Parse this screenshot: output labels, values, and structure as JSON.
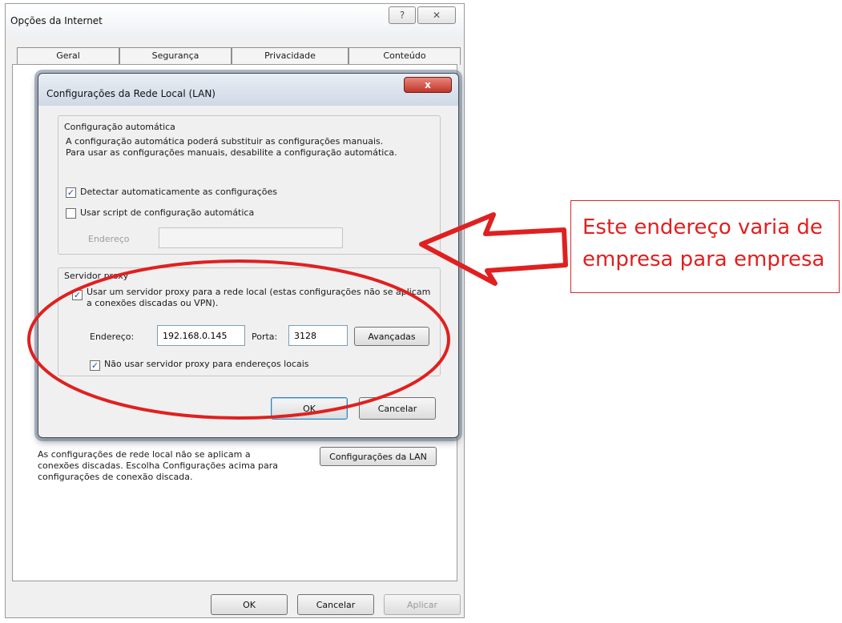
{
  "outer_window": {
    "title": "Opções da Internet",
    "help_label": "?",
    "close_label": "✕",
    "tabs": [
      "Geral",
      "Segurança",
      "Privacidade",
      "Conteúdo"
    ],
    "lan_note": "As configurações de rede local não se aplicam a conexões discadas. Escolha Configurações acima para configurações de conexão discada.",
    "lan_settings_button": "Configurações da LAN",
    "buttons": {
      "ok": "OK",
      "cancel": "Cancelar",
      "apply": "Aplicar"
    }
  },
  "lan_dialog": {
    "title": "Configurações da Rede Local (LAN)",
    "close_label": "x",
    "auto_config": {
      "legend": "Configuração automática",
      "description": "A configuração automática poderá substituir as configurações manuais. Para usar as configurações manuais, desabilite a configuração automática.",
      "detect_label": "Detectar automaticamente as configurações",
      "detect_checked": true,
      "script_label": "Usar script de configuração automática",
      "script_checked": false,
      "address_label": "Endereço"
    },
    "proxy": {
      "legend": "Servidor proxy",
      "use_proxy_label": "Usar um servidor proxy para a rede local (estas configurações não se aplicam a conexões discadas ou VPN).",
      "use_proxy_checked": true,
      "address_label": "Endereço:",
      "address_value": "192.168.0.145",
      "port_label": "Porta:",
      "port_value": "3128",
      "advanced_button": "Avançadas",
      "bypass_local_label": "Não usar servidor proxy para endereços locais",
      "bypass_local_checked": true
    },
    "buttons": {
      "ok": "OK",
      "cancel": "Cancelar"
    }
  },
  "annotation": {
    "line1": "Este endereço varia de",
    "line2": "empresa para empresa",
    "color": "#e02020"
  },
  "icons": {
    "check": "✓"
  }
}
